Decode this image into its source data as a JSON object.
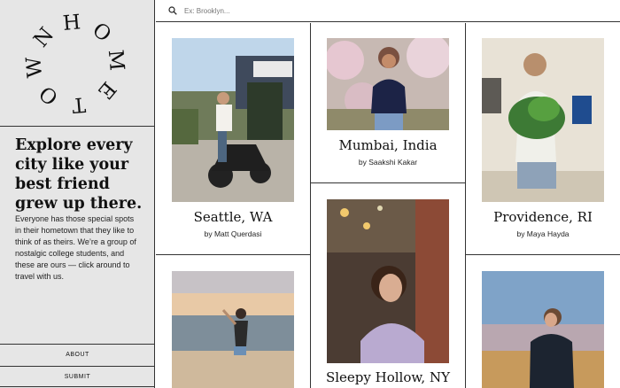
{
  "brand": {
    "logo_text": "HOMETOWN"
  },
  "sidebar": {
    "tagline": "Explore every city like your best friend grew up there.",
    "blurb": "Everyone has those special spots in their hometown that they like to think of as theirs. We’re a group of nostalgic college students, and these are ours — click around to travel with us.",
    "nav": [
      {
        "label": "ABOUT"
      },
      {
        "label": "SUBMIT"
      }
    ]
  },
  "search": {
    "placeholder": "Ex: Brooklyn...",
    "value": ""
  },
  "cards": [
    {
      "title": "Seattle, WA",
      "byline": "by Matt Querdasi"
    },
    {
      "title": "Mumbai, India",
      "byline": "by Saakshi Kakar"
    },
    {
      "title": "Providence, RI",
      "byline": "by Maya Hayda"
    },
    {
      "title": "",
      "byline": ""
    },
    {
      "title": "Sleepy Hollow, NY",
      "byline": ""
    },
    {
      "title": "",
      "byline": ""
    }
  ],
  "colors": {
    "sidebar_bg": "#e6e6e6",
    "grid_line": "#333333",
    "card_bg": "#ffffff",
    "text": "#111111"
  }
}
